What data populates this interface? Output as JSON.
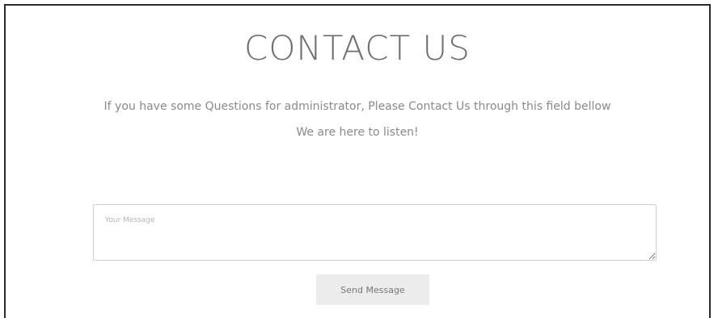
{
  "contact": {
    "title": "CONTACT US",
    "intro": "If you have some Questions for administrator, Please Contact Us through this field bellow",
    "subtext": "We are here to listen!",
    "message_placeholder": "Your Message",
    "message_value": "",
    "send_label": "Send Message"
  }
}
